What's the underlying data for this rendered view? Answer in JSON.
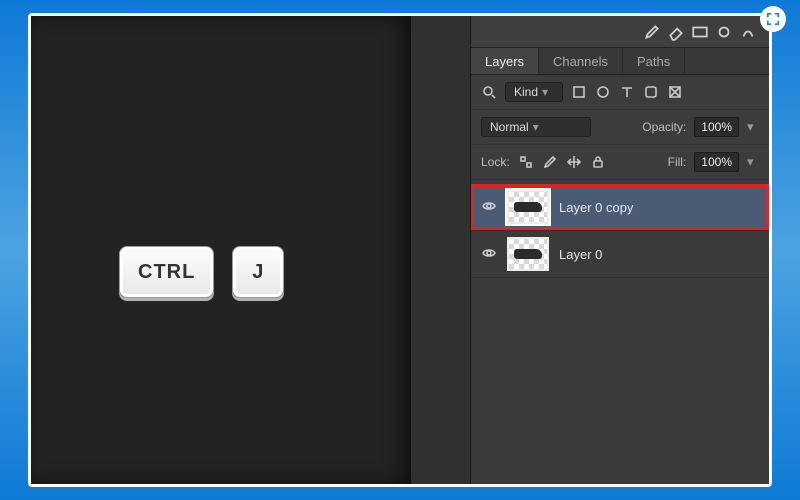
{
  "toolstrip_icons": [
    "brush",
    "eraser",
    "gradient",
    "clone",
    "smudge"
  ],
  "panel_tabs": {
    "items": [
      {
        "label": "Layers",
        "active": true
      },
      {
        "label": "Channels",
        "active": false
      },
      {
        "label": "Paths",
        "active": false
      }
    ]
  },
  "filter_row": {
    "filter_icon": "search",
    "kind_label": "Kind",
    "type_icons": [
      "pixel",
      "adjustment",
      "type",
      "shape",
      "smart"
    ]
  },
  "blend_row": {
    "mode": "Normal",
    "opacity_label": "Opacity:",
    "opacity_value": "100%"
  },
  "lock_row": {
    "lock_label": "Lock:",
    "lock_icons": [
      "pixels",
      "brush",
      "move",
      "all"
    ],
    "fill_label": "Fill:",
    "fill_value": "100%"
  },
  "layers": [
    {
      "name": "Layer 0 copy",
      "visible": true,
      "selected": true,
      "highlighted": true
    },
    {
      "name": "Layer 0",
      "visible": true,
      "selected": false,
      "highlighted": false
    }
  ],
  "shortcut": {
    "keys": [
      "CTRL",
      "J"
    ]
  }
}
